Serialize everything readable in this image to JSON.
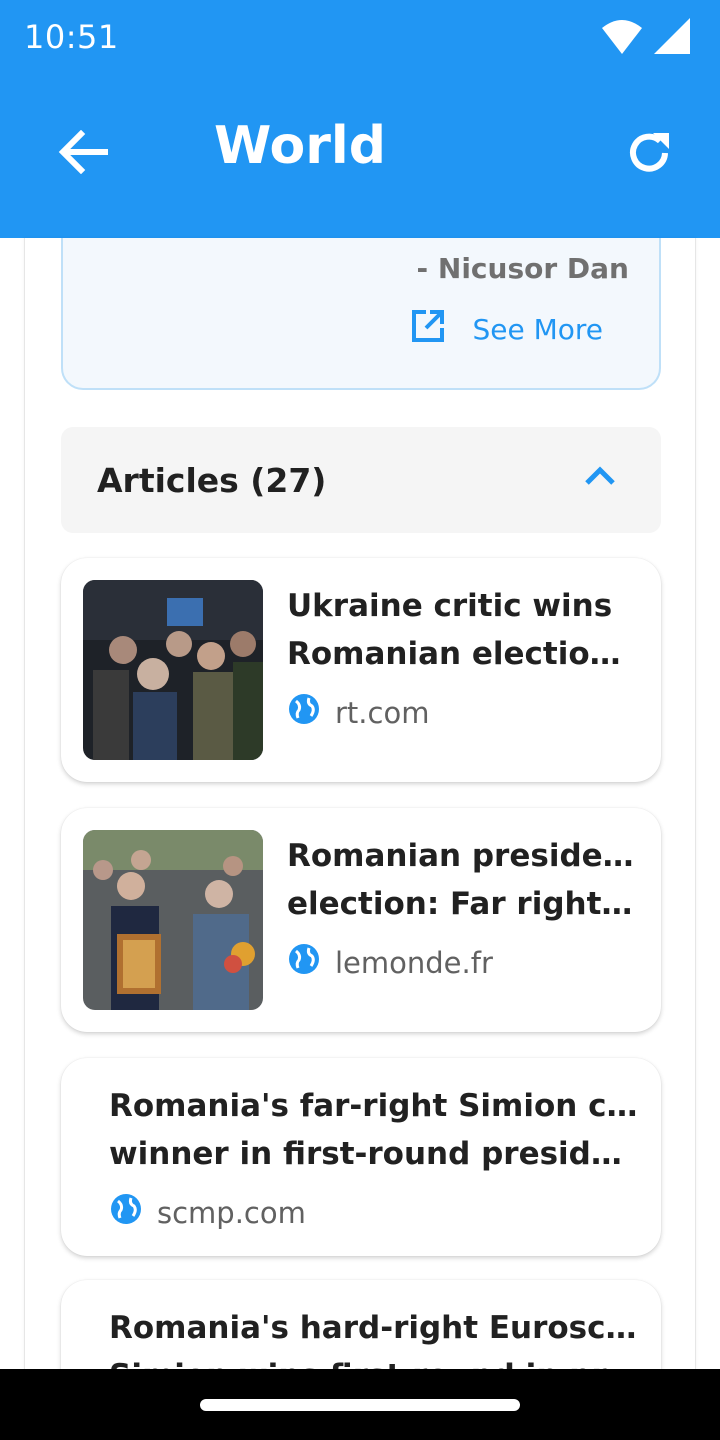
{
  "status_bar": {
    "time": "10:51"
  },
  "app_bar": {
    "title": "World"
  },
  "summary": {
    "author": "- Nicusor Dan",
    "see_more_label": "See More"
  },
  "articles_section": {
    "title": "Articles (27)"
  },
  "articles": [
    {
      "title_line1": "Ukraine critic wins",
      "title_line2": "Romanian election fi…",
      "source": "rt.com",
      "has_image": true
    },
    {
      "title_line1": "Romanian presidential",
      "title_line2": "election: Far right cli…",
      "source": "lemonde.fr",
      "has_image": true
    },
    {
      "title_line1": "Romania's far-right Simion clear",
      "title_line2": "winner in first-round presidentia…",
      "source": "scmp.com",
      "has_image": false
    },
    {
      "title_line1": "Romania's hard-right Eurosceptic",
      "title_line2": "Simion wins first round in presid…",
      "source": "",
      "has_image": false
    }
  ],
  "colors": {
    "primary": "#2196f3",
    "summary_bg": "#f3f8fd",
    "summary_border": "#bfe0f8",
    "header_bg": "#f5f5f5"
  },
  "icons": [
    "wifi-icon",
    "signal-icon",
    "back-arrow-icon",
    "refresh-icon",
    "open-in-new-icon",
    "chevron-up-icon",
    "globe-icon"
  ]
}
